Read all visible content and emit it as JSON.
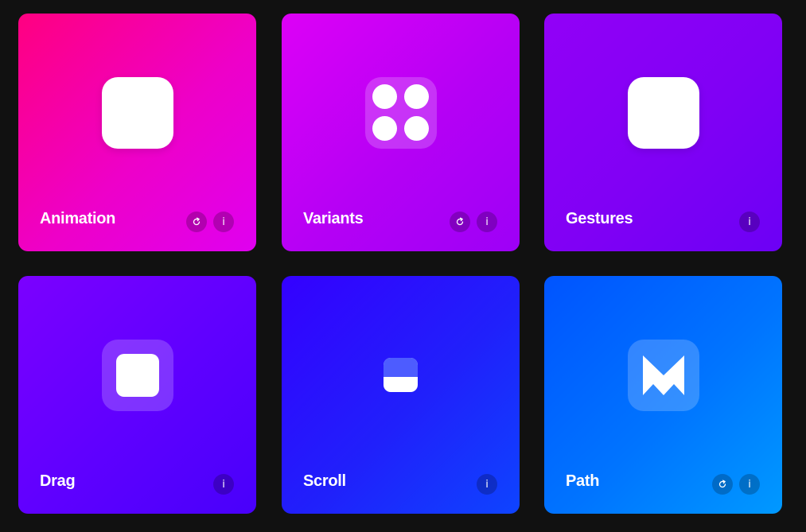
{
  "cards": [
    {
      "title": "Animation",
      "buttons": [
        "refresh",
        "info"
      ]
    },
    {
      "title": "Variants",
      "buttons": [
        "refresh",
        "info"
      ]
    },
    {
      "title": "Gestures",
      "buttons": [
        "info"
      ]
    },
    {
      "title": "Drag",
      "buttons": [
        "info"
      ]
    },
    {
      "title": "Scroll",
      "buttons": [
        "info"
      ]
    },
    {
      "title": "Path",
      "buttons": [
        "refresh",
        "info"
      ]
    }
  ],
  "info_label": "i",
  "icons": {
    "refresh": "refresh-icon",
    "info": "info-icon"
  },
  "colors": {
    "page_background": "#111111",
    "animation": "#ff0080",
    "variants": "#dd00f6",
    "gestures": "#9200f7",
    "drag": "#7b00ff",
    "scroll": "#3400ff",
    "path": "#0099ff"
  }
}
